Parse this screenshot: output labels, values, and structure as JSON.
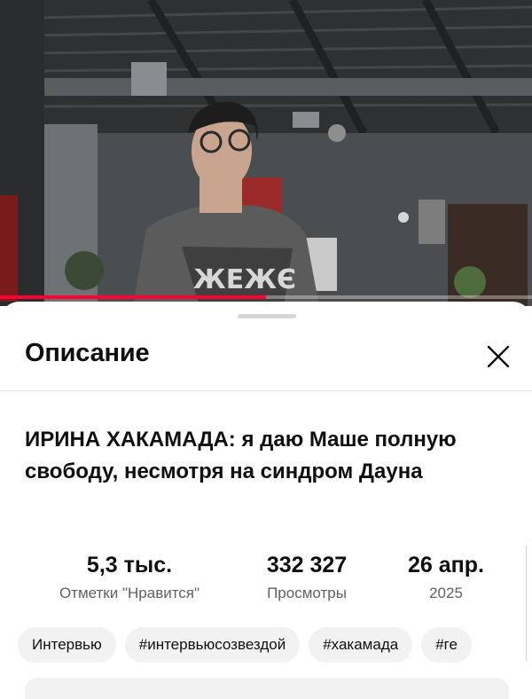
{
  "sheet": {
    "title": "Описание",
    "close_icon": "close-icon"
  },
  "video": {
    "title": "ИРИНА ХАКАМАДА: я даю Маше полную свободу, несмотря на синдром Дауна",
    "progress_fraction": 0.5,
    "progress_color": "#ff0033"
  },
  "stats": {
    "likes": {
      "value": "5,3 тыс.",
      "label": "Отметки \"Нравится\""
    },
    "views": {
      "value": "332 327",
      "label": "Просмотры"
    },
    "date": {
      "value": "26 апр.",
      "label": "2025"
    }
  },
  "tags": [
    "Интервью",
    "#интервьюсозвездой",
    "#хакамада",
    "#ге"
  ]
}
